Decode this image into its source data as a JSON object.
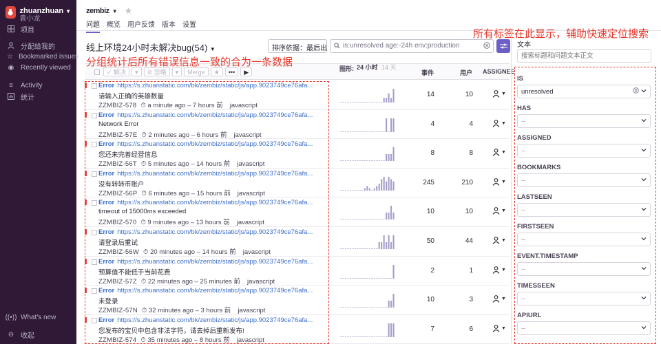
{
  "sidebar": {
    "user_name": "zhuanzhuan",
    "user_sub": "袁小龙",
    "items": [
      {
        "label": "项目",
        "icon": "grid-icon"
      },
      {
        "label": "分配给我的",
        "icon": "person-icon"
      },
      {
        "label": "Bookmarked issues",
        "icon": "star-icon"
      },
      {
        "label": "Recently viewed",
        "icon": "eye-icon"
      },
      {
        "label": "Activity",
        "icon": "list-icon"
      },
      {
        "label": "统计",
        "icon": "chart-icon"
      }
    ],
    "whats_new": "What's new",
    "collapse": "收起"
  },
  "project": {
    "name": "zembiz"
  },
  "tabs": [
    "问题",
    "概览",
    "用户反馈",
    "版本",
    "设置"
  ],
  "page_title": "线上环境24小时未解决bug(54)",
  "sort_label": "排序依据：最后出...",
  "search_value": "is:unresolved age:-24h env:production",
  "annotations": {
    "left": "分组统计后所有错误信息一致的合为一条数据",
    "right": "所有标签在此显示，辅助快速定位搜索"
  },
  "list_header": {
    "actions": [
      "解决",
      "忽略",
      "Merge"
    ],
    "graph_label": "图形:",
    "graph_24h": "24 小时",
    "graph_14d": "14 天",
    "events": "事件",
    "users": "用户",
    "assignee": "ASSIGNEE"
  },
  "issues": [
    {
      "level": "Error",
      "url": "https://s.zhuanstatic.com/bk/zembiz/static/js/app.9023749ce76afa...",
      "message": "请输入正确的英雄数量",
      "short_id": "ZZMBIZ-578",
      "time": "a minute ago – 7 hours 前",
      "platform": "javascript",
      "events": "14",
      "users": "10",
      "spark": [
        0,
        0,
        0,
        0,
        0,
        0,
        0,
        0,
        0,
        0,
        0,
        0,
        0,
        0,
        0,
        0,
        0,
        0,
        1,
        1,
        2,
        1,
        3
      ]
    },
    {
      "level": "Error",
      "url": "https://s.zhuanstatic.com/bk/zembiz/static/js/app.9023749ce76afa...",
      "message": "Network Error",
      "short_id": "ZZMBIZ-57E",
      "time": "2 minutes ago – 6 hours 前",
      "platform": "javascript",
      "events": "4",
      "users": "4",
      "spark": [
        0,
        0,
        0,
        0,
        0,
        0,
        0,
        0,
        0,
        0,
        0,
        0,
        0,
        0,
        0,
        0,
        0,
        0,
        0,
        1,
        0,
        1,
        1
      ]
    },
    {
      "level": "Error",
      "url": "https://s.zhuanstatic.com/bk/zembiz/static/js/app.9023749ce76afa...",
      "message": "您还未完善经营信息",
      "short_id": "ZZMBIZ-56T",
      "time": "5 minutes ago – 14 hours 前",
      "platform": "javascript",
      "events": "8",
      "users": "8",
      "spark": [
        0,
        0,
        0,
        0,
        0,
        0,
        0,
        0,
        0,
        0,
        0,
        0,
        0,
        0,
        0,
        0,
        0,
        0,
        0,
        1,
        1,
        1,
        2
      ]
    },
    {
      "level": "Error",
      "url": "https://s.zhuanstatic.com/bk/zembiz/static/js/app.9023749ce76afa...",
      "message": "没有转转币账户",
      "short_id": "ZZMBIZ-56P",
      "time": "6 minutes ago – 15 hours 前",
      "platform": "javascript",
      "events": "245",
      "users": "210",
      "spark": [
        0,
        0,
        0,
        0,
        0,
        0,
        0,
        0,
        0,
        0,
        1,
        2,
        1,
        0,
        1,
        2,
        3,
        5,
        6,
        4,
        6,
        5,
        4
      ]
    },
    {
      "level": "Error",
      "url": "https://s.zhuanstatic.com/bk/zembiz/static/js/app.9023749ce76afa...",
      "message": "timeout of 15000ms exceeded",
      "short_id": "ZZMBIZ-570",
      "time": "9 minutes ago – 13 hours 前",
      "platform": "javascript",
      "events": "10",
      "users": "10",
      "spark": [
        0,
        0,
        0,
        0,
        0,
        0,
        0,
        0,
        0,
        0,
        0,
        0,
        0,
        0,
        0,
        0,
        0,
        0,
        0,
        1,
        1,
        2,
        1
      ]
    },
    {
      "level": "Error",
      "url": "https://s.zhuanstatic.com/bk/zembiz/static/js/app.9023749ce76afa...",
      "message": "请登录后重试",
      "short_id": "ZZMBIZ-56W",
      "time": "20 minutes ago – 14 hours 前",
      "platform": "javascript",
      "events": "50",
      "users": "44",
      "spark": [
        0,
        0,
        0,
        0,
        0,
        0,
        0,
        0,
        0,
        0,
        0,
        0,
        0,
        0,
        0,
        0,
        1,
        1,
        2,
        1,
        2,
        1,
        2
      ]
    },
    {
      "level": "Error",
      "url": "https://s.zhuanstatic.com/bk/zembiz/static/js/app.9023749ce76afa...",
      "message": "预算值不能低于当前花费",
      "short_id": "ZZMBIZ-57Z",
      "time": "22 minutes ago – 25 minutes 前",
      "platform": "javascript",
      "events": "2",
      "users": "1",
      "spark": [
        0,
        0,
        0,
        0,
        0,
        0,
        0,
        0,
        0,
        0,
        0,
        0,
        0,
        0,
        0,
        0,
        0,
        0,
        0,
        0,
        0,
        0,
        1
      ]
    },
    {
      "level": "Error",
      "url": "https://s.zhuanstatic.com/bk/zembiz/static/js/app.9023749ce76afa...",
      "message": "未登录",
      "short_id": "ZZMBIZ-57N",
      "time": "32 minutes ago – 3 hours 前",
      "platform": "javascript",
      "events": "10",
      "users": "3",
      "spark": [
        0,
        0,
        0,
        0,
        0,
        0,
        0,
        0,
        0,
        0,
        0,
        0,
        0,
        0,
        0,
        0,
        0,
        0,
        0,
        0,
        1,
        1,
        2
      ]
    },
    {
      "level": "Error",
      "url": "https://s.zhuanstatic.com/bk/zembiz/static/js/app.9023749ce76afa...",
      "message": "您发布的宝贝中包含非法字符，请去掉后重新发布!",
      "short_id": "ZZMBIZ-574",
      "time": "35 minutes ago – 8 hours 前",
      "platform": "javascript",
      "events": "7",
      "users": "6",
      "spark": [
        0,
        0,
        0,
        0,
        0,
        0,
        0,
        0,
        0,
        0,
        0,
        0,
        0,
        0,
        0,
        0,
        0,
        0,
        0,
        0,
        1,
        1,
        1
      ]
    }
  ],
  "right_panel": {
    "text_label": "文本",
    "text_placeholder": "搜索标题和问题文本正文",
    "facets": [
      {
        "label": "IS",
        "value": "unresolved",
        "has_value": true
      },
      {
        "label": "HAS",
        "value": "--",
        "has_value": false
      },
      {
        "label": "ASSIGNED",
        "value": "--",
        "has_value": false
      },
      {
        "label": "BOOKMARKS",
        "value": "--",
        "has_value": false
      },
      {
        "label": "LASTSEEN",
        "value": "--",
        "has_value": false
      },
      {
        "label": "FIRSTSEEN",
        "value": "--",
        "has_value": false
      },
      {
        "label": "EVENT.TIMESTAMP",
        "value": "--",
        "has_value": false
      },
      {
        "label": "TIMESSEEN",
        "value": "--",
        "has_value": false
      },
      {
        "label": "APIURL",
        "value": "--",
        "has_value": false
      }
    ]
  },
  "colors": {
    "accent": "#6c5fc7",
    "sidebar": "#2f1937",
    "error": "#e0493d",
    "annotation": "#e8372a",
    "spark": "#a59ec9"
  }
}
